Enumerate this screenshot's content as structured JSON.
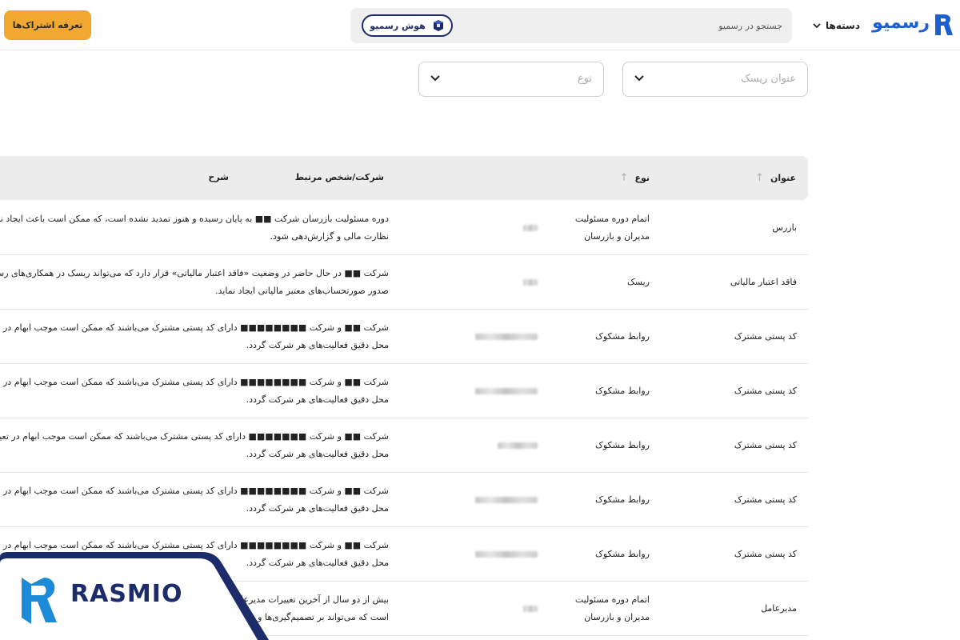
{
  "header": {
    "logo_text": "رسمیو",
    "categories_label": "دسته‌ها",
    "search_placeholder": "جستجو در رسمیو",
    "ai_button_label": "هوش رسمیو",
    "pricing_button_label": "تعرفه اشتراک‌ها"
  },
  "filters": {
    "risk_title_placeholder": "عنوان ریسک",
    "type_placeholder": "نوع"
  },
  "table": {
    "columns": {
      "title": "عنوان",
      "type": "نوع",
      "company": "شرکت/شخص مرتبط",
      "description": "شرح"
    },
    "rows": [
      {
        "title": "بازرس",
        "type": [
          "اتمام دوره مسئولیت",
          "مدیران و بازرسان"
        ],
        "company_redacted": "short",
        "description": [
          "دوره مسئولیت بازرسان شرکت ■■ به پایان رسیده و هنوز تمدید نشده است، که ممکن است باعث ایجاد نگرانی",
          "نظارت مالی و گزارش‌دهی شود."
        ]
      },
      {
        "title": "فاقد اعتبار مالیاتی",
        "type": [
          "ریسک"
        ],
        "company_redacted": "short",
        "description": [
          "شرکت ■■ در حال حاضر در وضعیت «فاقد اعتبار مالیاتی» قرار دارد که می‌تواند ریسک در همکاری‌های رسمی",
          "صدور صورتحساب‌های معتبر مالیاتی ایجاد نماید."
        ]
      },
      {
        "title": "کد پستی مشترک",
        "type": [
          "روابط مشکوک"
        ],
        "company_redacted": "long",
        "description": [
          "شرکت ■■ و شرکت ■■■■■■■■ دارای کد پستی مشترک می‌باشند که ممکن است موجب ابهام در تعیین",
          "محل دقیق فعالیت‌های هر شرکت گردد."
        ]
      },
      {
        "title": "کد پستی مشترک",
        "type": [
          "روابط مشکوک"
        ],
        "company_redacted": "long",
        "description": [
          "شرکت ■■ و شرکت ■■■■■■■■ دارای کد پستی مشترک می‌باشند که ممکن است موجب ابهام در تعیین",
          "محل دقیق فعالیت‌های هر شرکت گردد."
        ]
      },
      {
        "title": "کد پستی مشترک",
        "type": [
          "روابط مشکوک"
        ],
        "company_redacted": "medium",
        "description": [
          "شرکت ■■ و شرکت ■■■■■■■ دارای کد پستی مشترک می‌باشند که ممکن است موجب ابهام در تعیین",
          "محل دقیق فعالیت‌های هر شرکت گردد."
        ]
      },
      {
        "title": "کد پستی مشترک",
        "type": [
          "روابط مشکوک"
        ],
        "company_redacted": "long",
        "description": [
          "شرکت ■■ و شرکت ■■■■■■■■ دارای کد پستی مشترک می‌باشند که ممکن است موجب ابهام در تعیین",
          "محل دقیق فعالیت‌های هر شرکت گردد."
        ]
      },
      {
        "title": "کد پستی مشترک",
        "type": [
          "روابط مشکوک"
        ],
        "company_redacted": "long",
        "description": [
          "شرکت ■■ و شرکت ■■■■■■■■ دارای کد پستی مشترک می‌باشند که ممکن است موجب ابهام در تعیین",
          "محل دقیق فعالیت‌های هر شرکت گردد."
        ]
      },
      {
        "title": "مدیرعامل",
        "type": [
          "اتمام دوره مسئولیت",
          "مدیران و بازرسان"
        ],
        "company_redacted": "short",
        "description": [
          "بیش از دو سال از آخرین تغییرات مدیرعامل",
          "است که می‌تواند بر تصمیم‌گیری‌ها و"
        ]
      }
    ]
  },
  "watermark": {
    "text": "RASMIO"
  },
  "colors": {
    "brand_blue": "#1c5fd0",
    "navy": "#1c2c6b",
    "pricing_orange": "#f0a830"
  }
}
